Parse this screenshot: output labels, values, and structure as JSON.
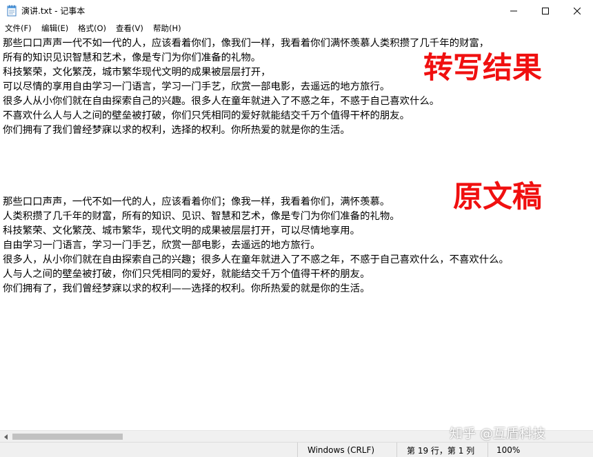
{
  "window": {
    "title": "演讲.txt - 记事本",
    "icon": "notepad-icon"
  },
  "menu": {
    "items": [
      "文件(F)",
      "编辑(E)",
      "格式(O)",
      "查看(V)",
      "帮助(H)"
    ]
  },
  "document": {
    "lines": [
      "那些口口声声一代不如一代的人，应该看着你们，像我们一样，我看着你们满怀羡慕人类积攒了几千年的财富，",
      "所有的知识见识智慧和艺术，像是专门为你们准备的礼物。",
      "科技繁荣，文化繁茂，城市繁华现代文明的成果被层层打开，",
      "可以尽情的享用自由学习一门语言，学习一门手艺，欣赏一部电影，去遥远的地方旅行。",
      "很多人从小你们就在自由探索自己的兴趣。很多人在童年就进入了不惑之年，不惑于自己喜欢什么。",
      "不喜欢什么人与人之间的壁垒被打破，你们只凭相同的爱好就能结交千万个值得干杯的朋友。",
      "你们拥有了我们曾经梦寐以求的权利，选择的权利。你所热爱的就是你的生活。",
      "",
      "",
      "",
      "那些口口声声，一代不如一代的人，应该看着你们；像我一样，我看着你们，满怀羡慕。",
      "人类积攒了几千年的财富，所有的知识、见识、智慧和艺术，像是专门为你们准备的礼物。",
      "科技繁荣、文化繁茂、城市繁华，现代文明的成果被层层打开，可以尽情地享用。",
      "自由学习一门语言，学习一门手艺，欣赏一部电影，去遥远的地方旅行。",
      "很多人，从小你们就在自由探索自己的兴趣；很多人在童年就进入了不惑之年，不惑于自己喜欢什么，不喜欢什么。",
      "人与人之间的壁垒被打破，你们只凭相同的爱好，就能结交千万个值得干杯的朋友。",
      "你们拥有了，我们曾经梦寐以求的权利——选择的权利。你所热爱的就是你的生活。"
    ]
  },
  "annotations": {
    "transcription_label": "转写结果",
    "original_label": "原文稿",
    "color": "#f01010"
  },
  "status": {
    "encoding": "Windows (CRLF)",
    "position": "第 19 行，第 1 列",
    "zoom": "100%"
  },
  "watermark": "知乎 @互盾科技"
}
